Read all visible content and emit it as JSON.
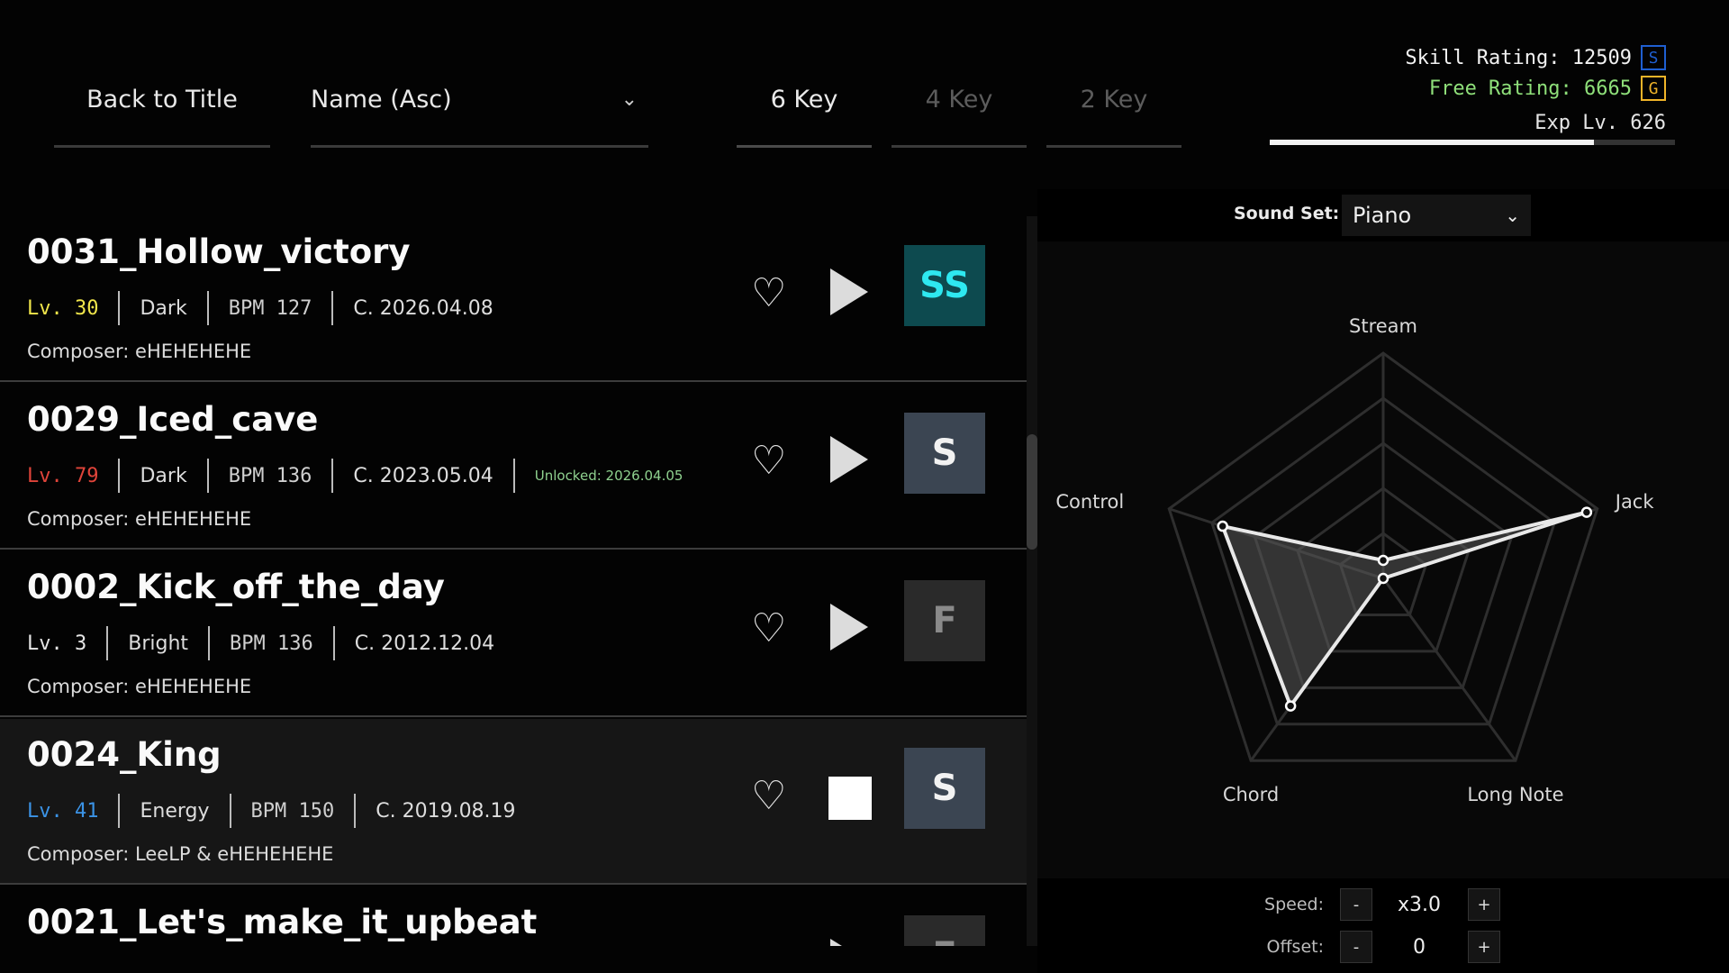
{
  "top_bar": {
    "back_label": "Back to Title",
    "sort_value": "Name (Asc)",
    "key_tabs": [
      {
        "label": "6 Key",
        "active": true
      },
      {
        "label": "4 Key",
        "active": false
      },
      {
        "label": "2 Key",
        "active": false
      }
    ]
  },
  "ratings": {
    "skill": {
      "label": "Skill Rating: 12509",
      "rank": "S",
      "color": "#1f5fd1"
    },
    "free": {
      "label": "Free Rating: 6665",
      "rank": "G",
      "color": "#f0b429"
    },
    "exp": {
      "label": "Exp Lv. 626",
      "progress": 0.8
    }
  },
  "songs": [
    {
      "title": "0031_Hollow_victory",
      "level": "Lv. 30",
      "level_color": "#f1e64b",
      "genre": "Dark",
      "bpm": "BPM 127",
      "date": "C. 2026.04.08",
      "unlocked": "",
      "composer": "Composer: eHEHEHEHE",
      "grade": "SS",
      "grade_class": "ss",
      "playing": false
    },
    {
      "title": "0029_Iced_cave",
      "level": "Lv. 79",
      "level_color": "#e0443a",
      "genre": "Dark",
      "bpm": "BPM 136",
      "date": "C. 2023.05.04",
      "unlocked": "Unlocked: 2026.04.05",
      "composer": "Composer: eHEHEHEHE",
      "grade": "S",
      "grade_class": "s",
      "playing": false
    },
    {
      "title": "0002_Kick_off_the_day",
      "level": "Lv. 3",
      "level_color": "#e6e6e6",
      "genre": "Bright",
      "bpm": "BPM 136",
      "date": "C. 2012.12.04",
      "unlocked": "",
      "composer": "Composer: eHEHEHEHE",
      "grade": "F",
      "grade_class": "f",
      "playing": false
    },
    {
      "title": "0024_King",
      "level": "Lv. 41",
      "level_color": "#3b93e6",
      "genre": "Energy",
      "bpm": "BPM 150",
      "date": "C. 2019.08.19",
      "unlocked": "",
      "composer": "Composer: LeeLP & eHEHEHEHE",
      "grade": "S",
      "grade_class": "s",
      "playing": true
    },
    {
      "title": "0021_Let's_make_it_upbeat",
      "level": "",
      "level_color": "#e6e6e6",
      "genre": "",
      "bpm": "",
      "date": "",
      "unlocked": "",
      "composer": "",
      "grade": "F",
      "grade_class": "f",
      "playing": false
    }
  ],
  "sound_set": {
    "label": "Sound Set:",
    "value": "Piano"
  },
  "radar": {
    "axes": [
      "Stream",
      "Jack",
      "Long Note",
      "Chord",
      "Control"
    ],
    "values": [
      0.08,
      0.95,
      0.0,
      0.7,
      0.75
    ]
  },
  "settings": {
    "speed_label": "Speed:",
    "speed_value": "x3.0",
    "offset_label": "Offset:",
    "offset_value": "0",
    "minus": "-",
    "plus": "+"
  }
}
